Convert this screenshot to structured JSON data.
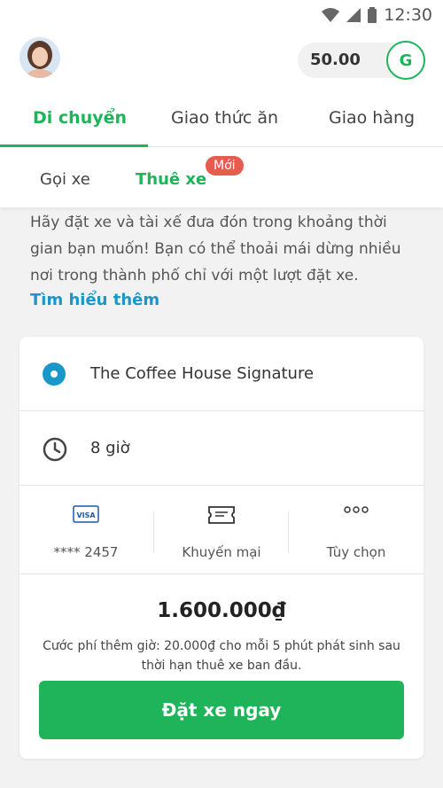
{
  "status_bar": {
    "time": "12:30"
  },
  "header": {
    "balance": "50.00",
    "badge": "G"
  },
  "tabs": [
    {
      "label": "Di chuyển",
      "active": true
    },
    {
      "label": "Giao thức ăn",
      "active": false
    },
    {
      "label": "Giao hàng",
      "active": false
    }
  ],
  "subtabs": [
    {
      "label": "Gọi xe",
      "active": false
    },
    {
      "label": "Thuê xe",
      "active": true,
      "badge": "Mới"
    }
  ],
  "description": "Hãy đặt xe và tài xế đưa đón trong khoảng thời gian bạn muốn! Bạn có thể thoải mái dừng nhiều nơi trong thành phố chỉ với một lượt đặt xe.",
  "learn_more": "Tìm hiểu thêm",
  "booking": {
    "pickup": "The Coffee House Signature",
    "duration": "8 giờ",
    "options": [
      {
        "icon": "visa-card-icon",
        "label": "**** 2457"
      },
      {
        "icon": "voucher-icon",
        "label": "Khuyến mại"
      },
      {
        "icon": "more-options-icon",
        "label": "Tùy chọn"
      }
    ],
    "visa_text": "VISA",
    "price": "1.600.000₫",
    "note": "Cước phí thêm giờ: 20.000₫ cho mỗi 5 phút phát sinh sau thời hạn thuê xe ban đầu.",
    "cta": "Đặt xe ngay"
  },
  "colors": {
    "primary": "#1fb45a",
    "link": "#1a97c9",
    "badge": "#e85b4f"
  }
}
